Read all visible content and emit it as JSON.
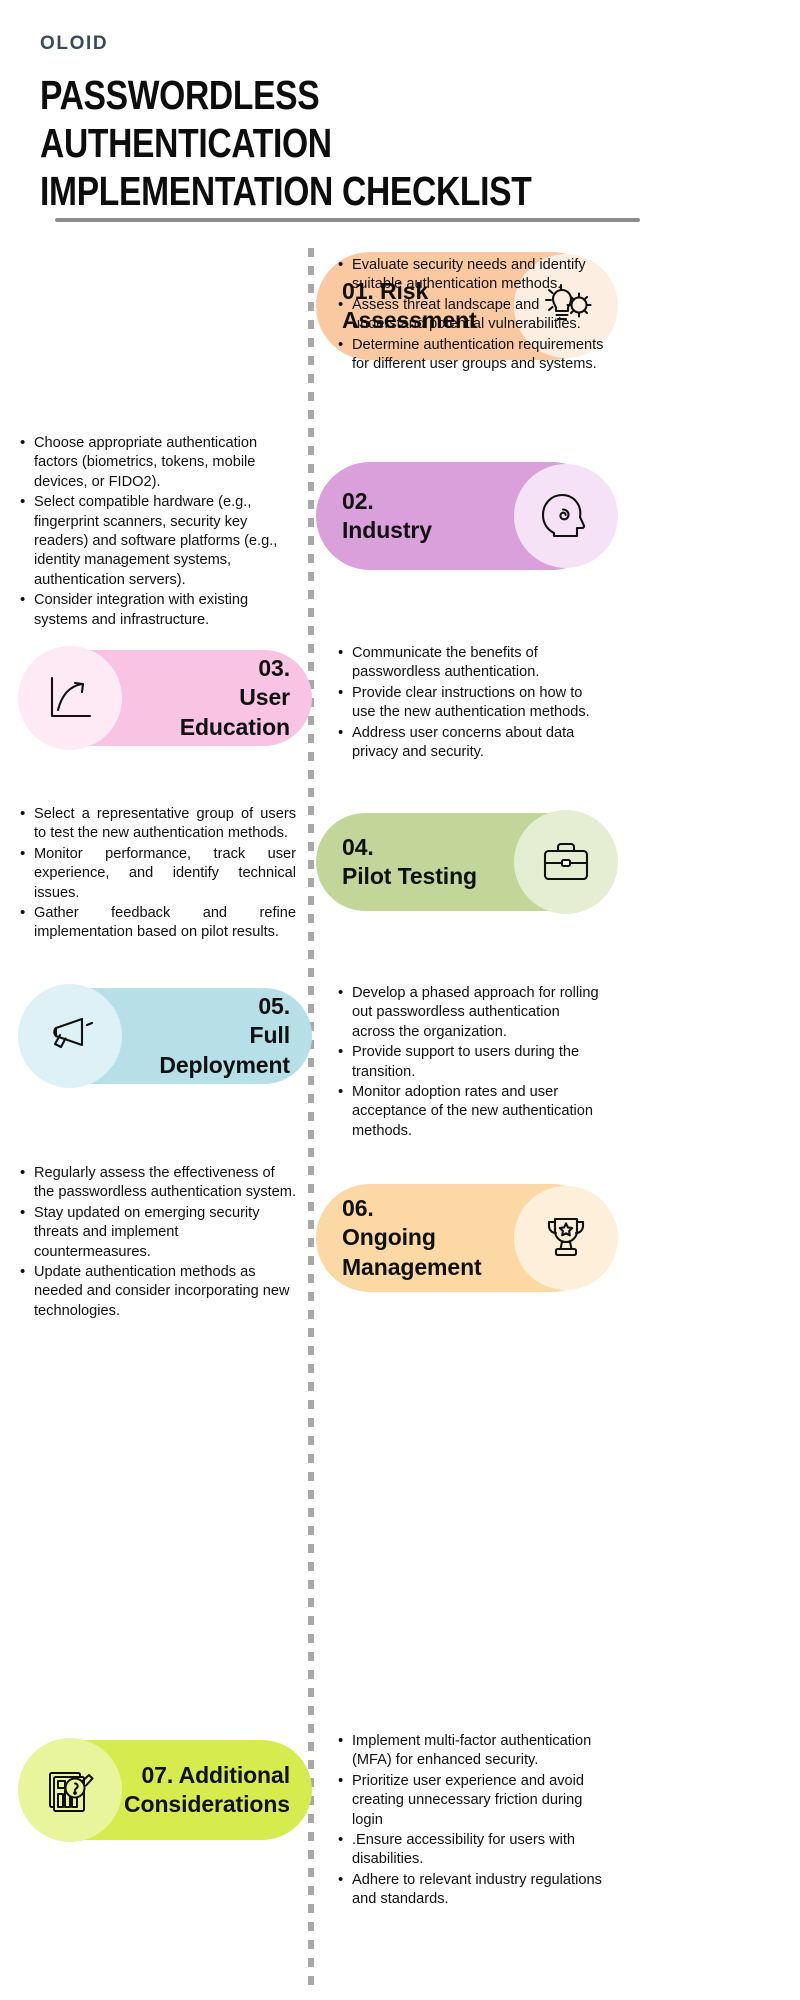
{
  "brand": "OLOID",
  "title": "PASSWORDLESS AUTHENTICATION IMPLEMENTATION CHECKLIST",
  "colors": {
    "brand_text": "#3a4a5c",
    "rule": "#8d8d8d",
    "spine": "#a8a8a8"
  },
  "sections": [
    {
      "number": "01.",
      "name": "Risk Assessment",
      "label": "01. Risk Assessment",
      "card_side": "right",
      "card_color": "#fac9a2",
      "disc_color": "#fdeee2",
      "icon": "lightbulb-gear-icon",
      "bullets_side": "right",
      "bullets": [
        "Evaluate security needs and identify suitable authentication methods.",
        "Assess threat landscape and understand potential vulnerabilities.",
        "Determine authentication requirements for different user groups and systems."
      ]
    },
    {
      "number": "02.",
      "name": "Industry",
      "label": "02. Industry",
      "card_side": "right",
      "card_color": "#d9a0dc",
      "disc_color": "#f6e2f7",
      "icon": "head-profile-icon",
      "bullets_side": "left",
      "bullets": [
        "Choose appropriate authentication factors (biometrics, tokens, mobile devices, or FIDO2).",
        "Select compatible hardware (e.g., fingerprint scanners, security key readers) and software platforms (e.g., identity management systems, authentication servers).",
        "Consider integration with existing systems and infrastructure."
      ]
    },
    {
      "number": "03.",
      "name": "User Education",
      "label": "03. User Education",
      "card_side": "left",
      "card_color": "#f9c4e4",
      "disc_color": "#fdeaf5",
      "icon": "growth-chart-icon",
      "bullets_side": "right",
      "bullets": [
        "Communicate the benefits of passwordless authentication.",
        "Provide clear instructions on how to use the new authentication methods.",
        "Address user concerns about data privacy and security."
      ]
    },
    {
      "number": "04.",
      "name": "Pilot Testing",
      "label": "04. Pilot Testing",
      "card_side": "right",
      "card_color": "#c2d69a",
      "disc_color": "#e5eed2",
      "icon": "briefcase-icon",
      "bullets_side": "left",
      "bullets": [
        "Select a representative group of users to test the new authentication methods.",
        "Monitor performance, track user experience, and identify technical issues.",
        "Gather feedback and refine implementation based on pilot results."
      ]
    },
    {
      "number": "05.",
      "name": "Full Deployment",
      "label": "05. Full Deployment",
      "card_side": "left",
      "card_color": "#b6dfe8",
      "disc_color": "#ddf1f6",
      "icon": "megaphone-icon",
      "bullets_side": "right",
      "bullets": [
        "Develop a phased approach for rolling out passwordless authentication across the organization.",
        "Provide support to users during the transition.",
        "Monitor adoption rates and user acceptance of the new authentication methods."
      ]
    },
    {
      "number": "06.",
      "name": "Ongoing Management",
      "label": "06. Ongoing Management",
      "card_side": "right",
      "card_color": "#fcd9a4",
      "disc_color": "#fdefd9",
      "icon": "trophy-icon",
      "bullets_side": "left",
      "bullets": [
        "Regularly assess the effectiveness of the passwordless authentication system.",
        "Stay updated on emerging security threats and implement countermeasures.",
        "Update authentication methods as needed and consider incorporating new technologies."
      ]
    },
    {
      "number": "07.",
      "name": "Additional Considerations",
      "label": "07. Additional Considerations",
      "card_side": "left",
      "card_color": "#d6ec4e",
      "disc_color": "#e9f59c",
      "icon": "document-magnifier-icon",
      "bullets_side": "right",
      "bullets": [
        "Implement multi-factor authentication (MFA) for enhanced security.",
        "Prioritize user experience and avoid creating unnecessary friction during login",
        ".Ensure accessibility for users with disabilities.",
        "Adhere to relevant industry regulations and standards."
      ]
    }
  ]
}
